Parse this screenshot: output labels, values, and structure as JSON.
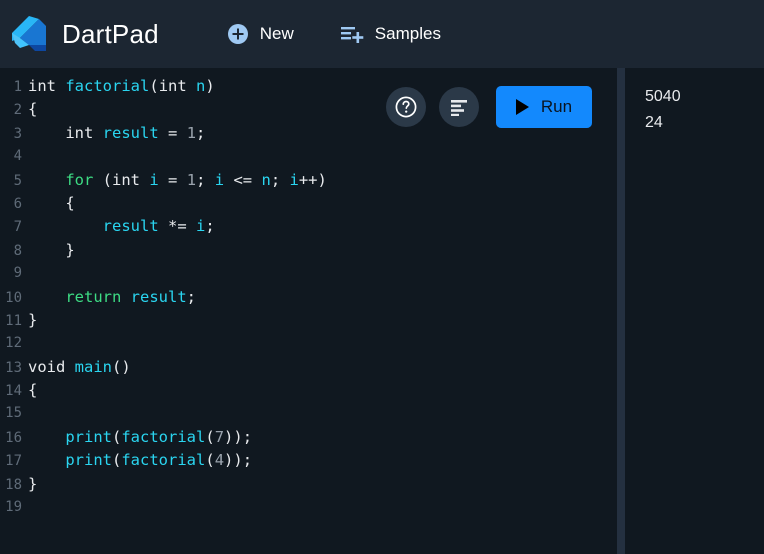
{
  "header": {
    "logo_icon": "dart-logo-icon",
    "title": "DartPad",
    "actions": [
      {
        "icon": "plus-circle-icon",
        "label": "New"
      },
      {
        "icon": "samples-list-plus-icon",
        "label": "Samples"
      }
    ]
  },
  "editor": {
    "toolbar": {
      "help_icon": "help-circle-icon",
      "format_icon": "format-code-icon",
      "run_icon": "play-icon",
      "run_label": "Run"
    },
    "lines": [
      {
        "num": "1",
        "tokens": [
          {
            "t": "type",
            "v": "int"
          },
          {
            "t": "plain",
            "v": " "
          },
          {
            "t": "ident",
            "v": "factorial"
          },
          {
            "t": "punct",
            "v": "("
          },
          {
            "t": "type",
            "v": "int"
          },
          {
            "t": "plain",
            "v": " "
          },
          {
            "t": "ident",
            "v": "n"
          },
          {
            "t": "punct",
            "v": ")"
          }
        ]
      },
      {
        "num": "2",
        "tokens": [
          {
            "t": "punct",
            "v": "{"
          }
        ]
      },
      {
        "num": "3",
        "tokens": [
          {
            "t": "plain",
            "v": "    "
          },
          {
            "t": "type",
            "v": "int"
          },
          {
            "t": "plain",
            "v": " "
          },
          {
            "t": "ident",
            "v": "result"
          },
          {
            "t": "plain",
            "v": " "
          },
          {
            "t": "punct",
            "v": "="
          },
          {
            "t": "plain",
            "v": " "
          },
          {
            "t": "num",
            "v": "1"
          },
          {
            "t": "punct",
            "v": ";"
          }
        ]
      },
      {
        "num": "4",
        "tokens": []
      },
      {
        "num": "5",
        "tokens": [
          {
            "t": "plain",
            "v": "    "
          },
          {
            "t": "kw",
            "v": "for"
          },
          {
            "t": "plain",
            "v": " "
          },
          {
            "t": "punct",
            "v": "("
          },
          {
            "t": "type",
            "v": "int"
          },
          {
            "t": "plain",
            "v": " "
          },
          {
            "t": "ident",
            "v": "i"
          },
          {
            "t": "plain",
            "v": " "
          },
          {
            "t": "punct",
            "v": "="
          },
          {
            "t": "plain",
            "v": " "
          },
          {
            "t": "num",
            "v": "1"
          },
          {
            "t": "punct",
            "v": ";"
          },
          {
            "t": "plain",
            "v": " "
          },
          {
            "t": "ident",
            "v": "i"
          },
          {
            "t": "plain",
            "v": " "
          },
          {
            "t": "punct",
            "v": "<="
          },
          {
            "t": "plain",
            "v": " "
          },
          {
            "t": "ident",
            "v": "n"
          },
          {
            "t": "punct",
            "v": ";"
          },
          {
            "t": "plain",
            "v": " "
          },
          {
            "t": "ident",
            "v": "i"
          },
          {
            "t": "punct",
            "v": "++)"
          }
        ]
      },
      {
        "num": "6",
        "tokens": [
          {
            "t": "plain",
            "v": "    "
          },
          {
            "t": "punct",
            "v": "{"
          }
        ]
      },
      {
        "num": "7",
        "tokens": [
          {
            "t": "plain",
            "v": "        "
          },
          {
            "t": "ident",
            "v": "result"
          },
          {
            "t": "plain",
            "v": " "
          },
          {
            "t": "punct",
            "v": "*="
          },
          {
            "t": "plain",
            "v": " "
          },
          {
            "t": "ident",
            "v": "i"
          },
          {
            "t": "punct",
            "v": ";"
          }
        ]
      },
      {
        "num": "8",
        "tokens": [
          {
            "t": "plain",
            "v": "    "
          },
          {
            "t": "punct",
            "v": "}"
          }
        ]
      },
      {
        "num": "9",
        "tokens": []
      },
      {
        "num": "10",
        "tokens": [
          {
            "t": "plain",
            "v": "    "
          },
          {
            "t": "kw",
            "v": "return"
          },
          {
            "t": "plain",
            "v": " "
          },
          {
            "t": "ident",
            "v": "result"
          },
          {
            "t": "punct",
            "v": ";"
          }
        ]
      },
      {
        "num": "11",
        "tokens": [
          {
            "t": "punct",
            "v": "}"
          }
        ]
      },
      {
        "num": "12",
        "tokens": []
      },
      {
        "num": "13",
        "tokens": [
          {
            "t": "type",
            "v": "void"
          },
          {
            "t": "plain",
            "v": " "
          },
          {
            "t": "ident",
            "v": "main"
          },
          {
            "t": "punct",
            "v": "()"
          }
        ]
      },
      {
        "num": "14",
        "tokens": [
          {
            "t": "punct",
            "v": "{"
          }
        ]
      },
      {
        "num": "15",
        "tokens": []
      },
      {
        "num": "16",
        "tokens": [
          {
            "t": "plain",
            "v": "    "
          },
          {
            "t": "ident",
            "v": "print"
          },
          {
            "t": "punct",
            "v": "("
          },
          {
            "t": "ident",
            "v": "factorial"
          },
          {
            "t": "punct",
            "v": "("
          },
          {
            "t": "num",
            "v": "7"
          },
          {
            "t": "punct",
            "v": "));"
          }
        ]
      },
      {
        "num": "17",
        "tokens": [
          {
            "t": "plain",
            "v": "    "
          },
          {
            "t": "ident",
            "v": "print"
          },
          {
            "t": "punct",
            "v": "("
          },
          {
            "t": "ident",
            "v": "factorial"
          },
          {
            "t": "punct",
            "v": "("
          },
          {
            "t": "num",
            "v": "4"
          },
          {
            "t": "punct",
            "v": "));"
          }
        ]
      },
      {
        "num": "18",
        "tokens": [
          {
            "t": "punct",
            "v": "}"
          }
        ]
      },
      {
        "num": "19",
        "tokens": []
      }
    ]
  },
  "output": {
    "lines": [
      "5040",
      "24"
    ]
  },
  "colors": {
    "header_bg": "#1c2632",
    "editor_bg": "#101820",
    "divider": "#243040",
    "accent_blue": "#1389fd",
    "icon_blue": "#9fc9f3",
    "keyword_green": "#3ddc84",
    "identifier_cyan": "#2ad5f0",
    "number_gray": "#9aa3ad",
    "text_white": "#e8eaed",
    "linenum_gray": "#5f6b78",
    "round_btn_bg": "#2b3948"
  }
}
